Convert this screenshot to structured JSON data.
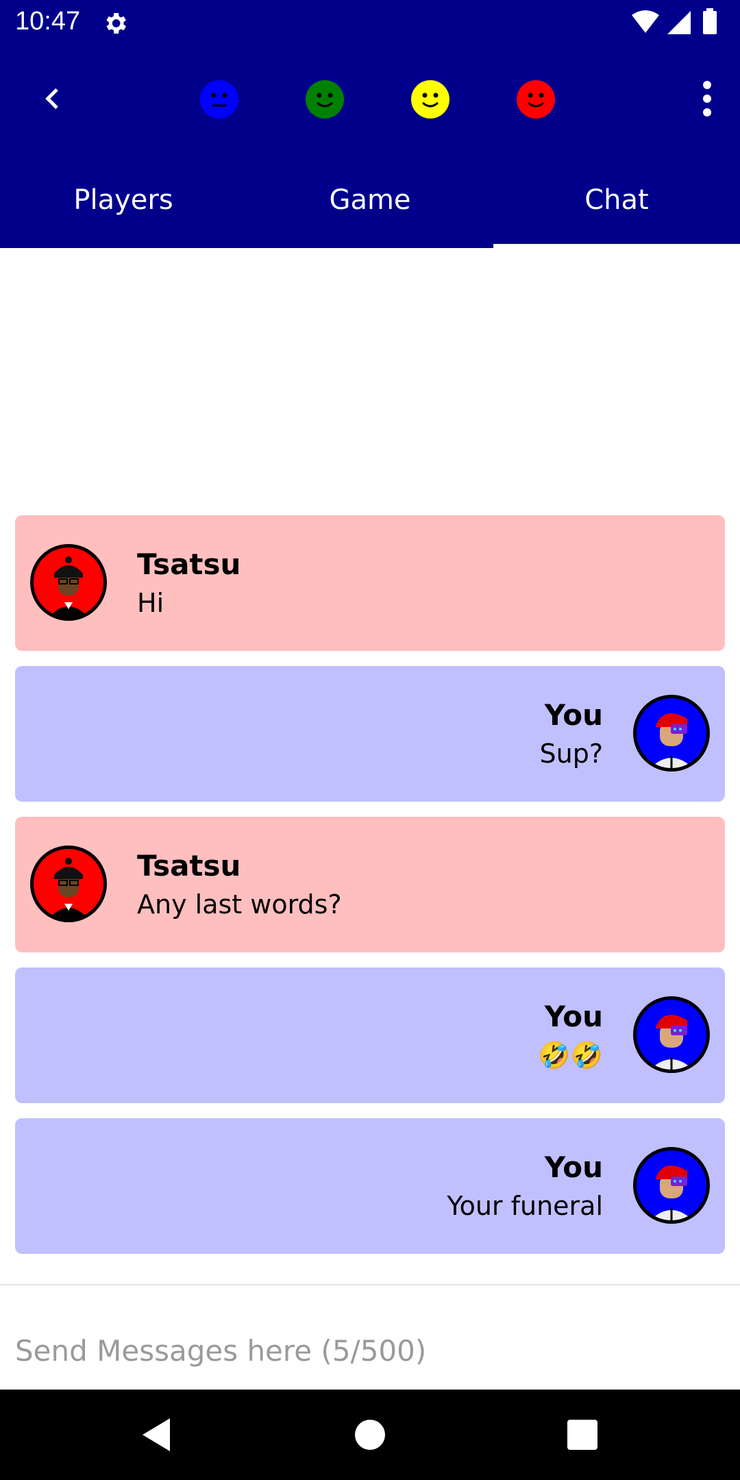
{
  "status_bar": {
    "time": "10:47",
    "settings_icon": "gear-icon",
    "wifi_icon": "wifi-icon",
    "signal_icon": "signal-icon",
    "battery_icon": "battery-icon"
  },
  "app_bar": {
    "back_icon": "back-arrow-icon",
    "menu_icon": "more-vert-icon",
    "player_faces": [
      {
        "icon": "neutral-face-icon",
        "color": "#0000ff"
      },
      {
        "icon": "smile-face-icon",
        "color": "#008000"
      },
      {
        "icon": "smile-face-icon",
        "color": "#ffff00"
      },
      {
        "icon": "smile-face-icon",
        "color": "#ff0000"
      }
    ]
  },
  "tabs": [
    {
      "label": "Players",
      "active": false
    },
    {
      "label": "Game",
      "active": false
    },
    {
      "label": "Chat",
      "active": true
    }
  ],
  "messages": [
    {
      "sender": "Tsatsu",
      "text": "Hi",
      "from_me": false
    },
    {
      "sender": "You",
      "text": "Sup?",
      "from_me": true
    },
    {
      "sender": "Tsatsu",
      "text": "Any last words?",
      "from_me": false
    },
    {
      "sender": "You",
      "text": "🤣🤣",
      "from_me": true
    },
    {
      "sender": "You",
      "text": "Your funeral",
      "from_me": true
    }
  ],
  "composer": {
    "placeholder": "Send Messages here (5/500)",
    "value": ""
  },
  "colors": {
    "primary": "#00008b",
    "opponent_bubble": "#ffbfbf",
    "own_bubble": "#c0c0ff"
  }
}
